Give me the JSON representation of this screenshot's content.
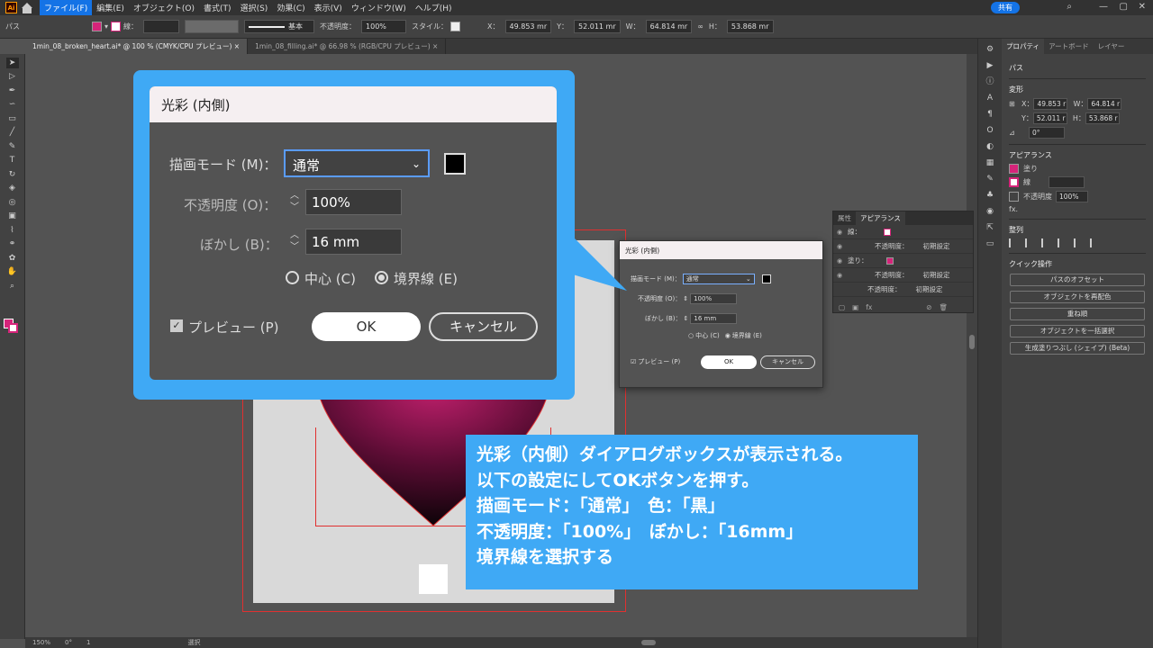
{
  "menubar": {
    "logo": "Ai",
    "items": [
      "ファイル(F)",
      "編集(E)",
      "オブジェクト(O)",
      "書式(T)",
      "選択(S)",
      "効果(C)",
      "表示(V)",
      "ウィンドウ(W)",
      "ヘルプ(H)"
    ],
    "active_index": 0,
    "share": "共有"
  },
  "controlbar": {
    "object_type": "パス",
    "stroke_label": "線：",
    "stroke_style": "基本",
    "opacity_label": "不透明度：",
    "opacity_value": "100%",
    "style_label": "スタイル：",
    "x_label": "X：",
    "x_value": "49.853 mr",
    "y_label": "Y：",
    "y_value": "52.011 mr",
    "w_label": "W：",
    "w_value": "64.814 mr",
    "h_label": "H：",
    "h_value": "53.868 mr",
    "fill_color": "#d6247a"
  },
  "tabs": [
    {
      "label": "1min_08_broken_heart.ai* @ 100 % (CMYK/CPU プレビュー)",
      "active": true
    },
    {
      "label": "1min_08_filling.ai* @ 66.98 % (RGB/CPU プレビュー)",
      "active": false
    }
  ],
  "statusbar": {
    "zoom": "150%",
    "rotation": "0°",
    "artboard": "1",
    "tool": "選択"
  },
  "appearance_panel": {
    "tabs": [
      "属性",
      "アピアランス"
    ],
    "rows": [
      {
        "label": "線：",
        "sub": ""
      },
      {
        "label": "不透明度：",
        "value": "初期設定"
      },
      {
        "label": "塗り：",
        "sub": ""
      },
      {
        "label": "不透明度：",
        "value": "初期設定"
      },
      {
        "label": "不透明度：",
        "value": "初期設定"
      }
    ]
  },
  "small_dialog": {
    "title": "光彩 (内側)",
    "mode_label": "描画モード (M)：",
    "mode_value": "通常",
    "opacity_label": "不透明度 (O)：",
    "opacity_value": "100%",
    "blur_label": "ぼかし (B)：",
    "blur_value": "16 mm",
    "center_label": "中心 (C)",
    "edge_label": "境界線 (E)",
    "preview_label": "プレビュー (P)",
    "ok": "OK",
    "cancel": "キャンセル"
  },
  "zoom_dialog": {
    "title": "光彩 (内側)",
    "mode_label": "描画モード (M)：",
    "mode_value": "通常",
    "opacity_label": "不透明度 (O)：",
    "opacity_value": "100%",
    "blur_label": "ぼかし (B)：",
    "blur_value": "16 mm",
    "center_label": "中心 (C)",
    "edge_label": "境界線 (E)",
    "preview_label": "プレビュー (P)",
    "ok": "OK",
    "cancel": "キャンセル"
  },
  "right_panel": {
    "tabs": [
      "プロパティ",
      "アートボード",
      "レイヤー"
    ],
    "object_type": "パス",
    "transform_head": "変形",
    "x_label": "X：",
    "x_value": "49.853 r",
    "y_label": "Y：",
    "y_value": "52.011 r",
    "w_label": "W：",
    "w_value": "64.814 r",
    "h_label": "H：",
    "h_value": "53.868 r",
    "angle": "0°",
    "appearance_head": "アピアランス",
    "fill_label": "塗り",
    "stroke_label": "線",
    "opacity_label": "不透明度",
    "opacity_value": "100%",
    "fx": "fx.",
    "align_head": "整列",
    "quick_head": "クイック操作",
    "quick_actions": [
      "パスのオフセット",
      "オブジェクトを再配色",
      "重ね順",
      "オブジェクトを一括選択",
      "生成塗りつぶし (シェイプ) (Beta)"
    ]
  },
  "annotation": {
    "lines": [
      "光彩（内側）ダイアログボックスが表示される。",
      "以下の設定にしてOKボタンを押す。",
      "描画モード：「通常」　色：「黒」",
      "不透明度：「100%」　ぼかし：「16mm」",
      "境界線を選択する"
    ]
  },
  "colors": {
    "accent": "#3fa9f5",
    "ui_blue": "#1473e6",
    "fill": "#d6247a"
  }
}
